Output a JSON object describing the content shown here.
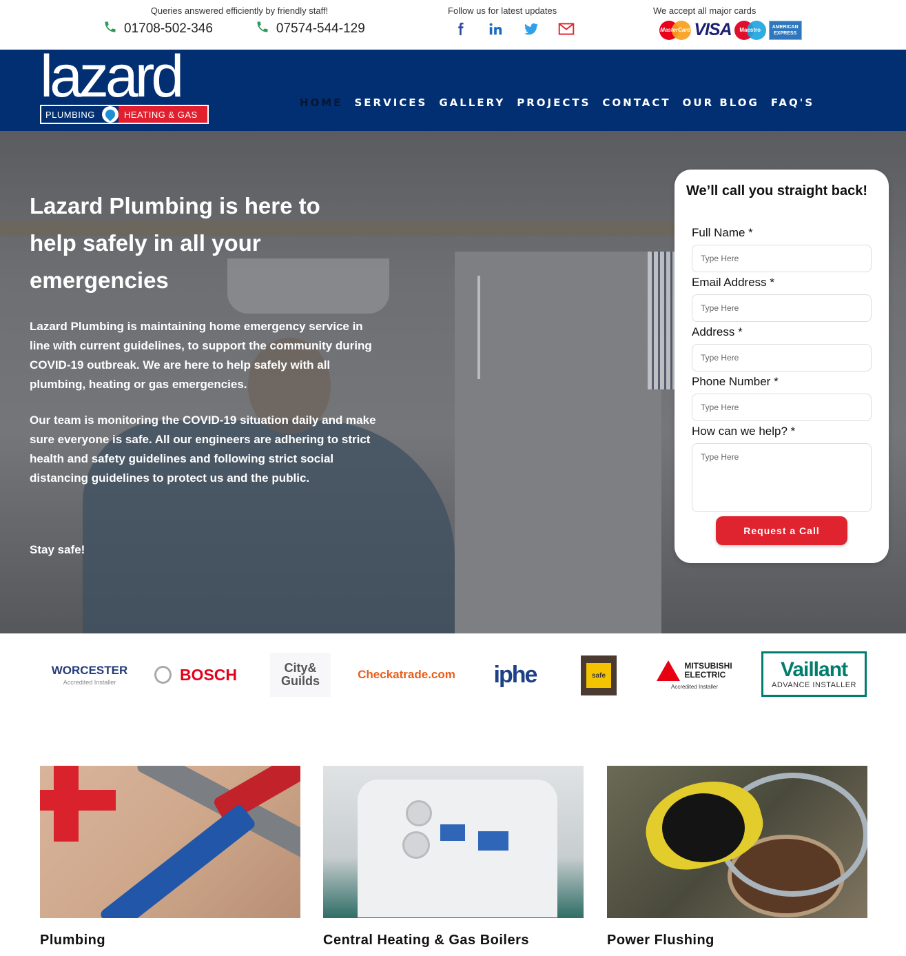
{
  "topbar": {
    "queries_caption": "Queries answered efficiently by friendly staff!",
    "phone1": "01708-502-346",
    "phone2": "07574-544-129",
    "follow_caption": "Follow us for latest updates",
    "social_icons": [
      "facebook-icon",
      "linkedin-icon",
      "twitter-icon",
      "email-icon"
    ],
    "cards_caption": "We accept all major cards",
    "card_mastercard": "MasterCard",
    "card_visa": "VISA",
    "card_maestro": "Maestro",
    "card_amex_1": "AMERICAN",
    "card_amex_2": "EXPRESS"
  },
  "logo": {
    "word": "lazard",
    "left": "PLUMBING",
    "right": "HEATING & GAS"
  },
  "nav": {
    "items": [
      "HOME",
      "SERVICES",
      "GALLERY",
      "PROJECTS",
      "CONTACT",
      "OUR BLOG",
      "FAQ'S"
    ],
    "active": "HOME"
  },
  "hero": {
    "title": "Lazard Plumbing is here to help safely in all your emergencies",
    "p1": "Lazard Plumbing is maintaining home emergency service in line with current guidelines, to support the community during COVID-19 outbreak. We are here to help safely with all plumbing, heating or gas emergencies.",
    "p2": "Our team is monitoring the COVID-19 situation daily and make sure everyone is safe. All our engineers are adhering to strict health and safety guidelines and following strict social distancing guidelines to protect us and the public.",
    "p3": "Stay safe!"
  },
  "callback_form": {
    "title": "We’ll call you straight back!",
    "fields": [
      {
        "label": "Full Name *",
        "placeholder": "Type Here"
      },
      {
        "label": "Email Address *",
        "placeholder": "Type Here"
      },
      {
        "label": "Address *",
        "placeholder": "Type Here"
      },
      {
        "label": "Phone Number *",
        "placeholder": "Type Here"
      },
      {
        "label": "How can we help? *",
        "placeholder": "Type Here"
      }
    ],
    "button": "Request a Call"
  },
  "accreditations": {
    "worcester": "WORCESTER",
    "worcester_sub": "Accredited Installer",
    "bosch": "BOSCH",
    "city_guilds_1": "City&",
    "city_guilds_2": "Guilds",
    "checkatrade": "Checkatrade.com",
    "iphe": "iphe",
    "gas_safe": "safe",
    "mitsubishi_1": "MITSUBISHI",
    "mitsubishi_2": "ELECTRIC",
    "mitsubishi_sub": "Accredited Installer",
    "vaillant": "Vaillant",
    "vaillant_sub": "ADVANCE INSTALLER"
  },
  "services": [
    {
      "title": "Plumbing"
    },
    {
      "title": "Central Heating & Gas Boilers"
    },
    {
      "title": "Power Flushing"
    }
  ],
  "colors": {
    "nav_bg": "#022f72",
    "accent_red": "#e0242f",
    "phone_icon": "#2e9a5a"
  }
}
